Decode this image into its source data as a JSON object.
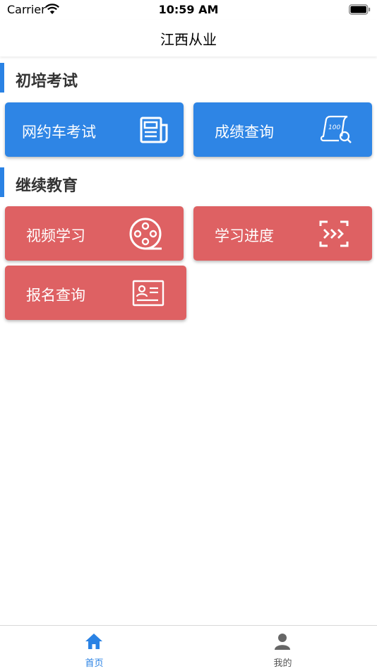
{
  "status_bar": {
    "carrier": "Carrier",
    "time": "10:59 AM"
  },
  "nav": {
    "title": "江西从业"
  },
  "sections": [
    {
      "title": "初培考试",
      "tiles": [
        {
          "label": "网约车考试",
          "icon": "newspaper-icon"
        },
        {
          "label": "成绩查询",
          "icon": "score-search-icon"
        }
      ]
    },
    {
      "title": "继续教育",
      "tiles": [
        {
          "label": "视频学习",
          "icon": "film-reel-icon"
        },
        {
          "label": "学习进度",
          "icon": "progress-arrows-icon"
        },
        {
          "label": "报名查询",
          "icon": "id-card-icon"
        }
      ]
    }
  ],
  "tab_bar": {
    "tabs": [
      {
        "label": "首页",
        "icon": "home-icon",
        "active": true
      },
      {
        "label": "我的",
        "icon": "user-icon",
        "active": false
      }
    ]
  },
  "colors": {
    "accent": "#2a82e4",
    "exam_tile": "#2e85e5",
    "education_tile": "#de6163"
  }
}
